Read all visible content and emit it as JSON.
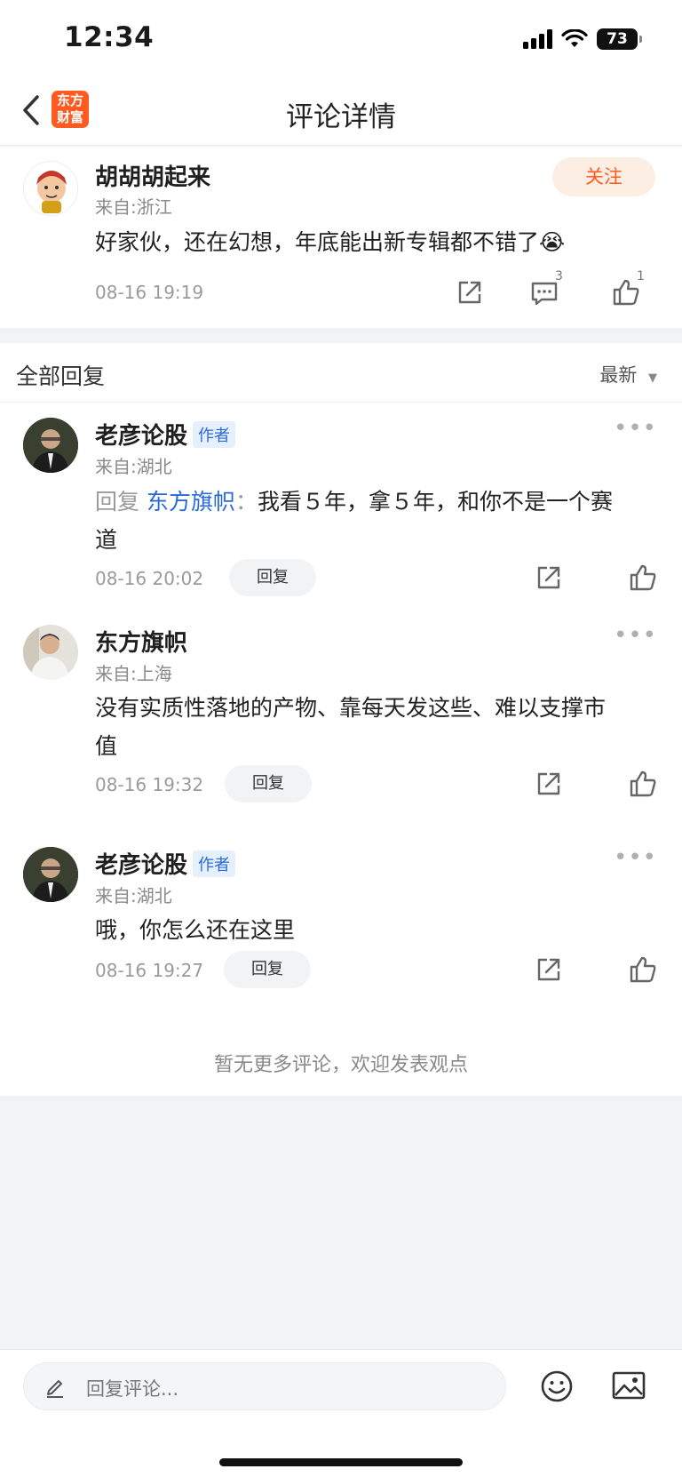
{
  "status": {
    "time": "12:34",
    "battery": "73"
  },
  "nav": {
    "title": "评论详情",
    "logo": "东方\n财富"
  },
  "main_comment": {
    "name": "胡胡胡起来",
    "from": "来自:浙江",
    "follow": "关注",
    "text": "好家伙，还在幻想，年底能出新专辑都不错了",
    "emoji": "😭",
    "date": "08-16 19:19",
    "comment_count": "3",
    "like_count": "1"
  },
  "replies_header": {
    "title": "全部回复",
    "sort": "最新"
  },
  "replies": [
    {
      "name": "老彦论股",
      "badge": "作者",
      "from": "来自:湖北",
      "reply_prefix": "回复",
      "reply_to": "东方旗帜",
      "separator": "：",
      "text_line1": "我看５年，拿５年，和你不是一个赛",
      "text_line2": "道",
      "date": "08-16 20:02",
      "reply_btn": "回复"
    },
    {
      "name": "东方旗帜",
      "from": "来自:上海",
      "text_line1": "没有实质性落地的产物、靠每天发这些、难以支撑市",
      "text_line2": "值",
      "date": "08-16 19:32",
      "reply_btn": "回复"
    },
    {
      "name": "老彦论股",
      "badge": "作者",
      "from": "来自:湖北",
      "text_line1": "哦，你怎么还在这里",
      "date": "08-16 19:27",
      "reply_btn": "回复"
    }
  ],
  "end_note": "暂无更多评论，欢迎发表观点",
  "input": {
    "placeholder": "回复评论..."
  },
  "colors": {
    "accent": "#ff5a1f",
    "link": "#2a6ad8"
  }
}
